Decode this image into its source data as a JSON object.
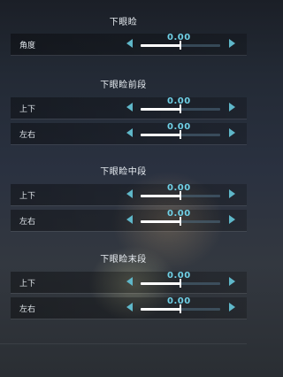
{
  "sections": [
    {
      "title": "下眼睑",
      "rows": [
        {
          "label": "角度",
          "value": "0.00",
          "level": 0.5
        }
      ]
    },
    {
      "title": "下眼睑前段",
      "rows": [
        {
          "label": "上下",
          "value": "0.00",
          "level": 0.5
        },
        {
          "label": "左右",
          "value": "0.00",
          "level": 0.5
        }
      ]
    },
    {
      "title": "下眼睑中段",
      "rows": [
        {
          "label": "上下",
          "value": "0.00",
          "level": 0.5
        },
        {
          "label": "左右",
          "value": "0.00",
          "level": 0.5
        }
      ]
    },
    {
      "title": "下眼睑末段",
      "rows": [
        {
          "label": "上下",
          "value": "0.00",
          "level": 0.5
        },
        {
          "label": "左右",
          "value": "0.00",
          "level": 0.5
        }
      ]
    }
  ],
  "colors": {
    "accent": "#6fd0e6",
    "arrow": "#5fb7c9",
    "fill": "#ffffff"
  },
  "icons": {
    "decrease": "triangle-left-icon",
    "increase": "triangle-right-icon"
  }
}
